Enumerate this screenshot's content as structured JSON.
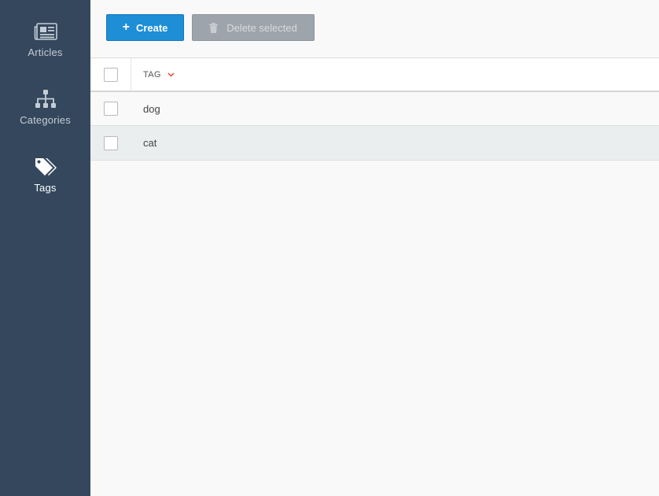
{
  "sidebar": {
    "items": [
      {
        "label": "Articles",
        "icon": "newspaper-icon",
        "active": false
      },
      {
        "label": "Categories",
        "icon": "sitemap-icon",
        "active": false
      },
      {
        "label": "Tags",
        "icon": "tags-icon",
        "active": true
      }
    ]
  },
  "toolbar": {
    "create_label": "Create",
    "delete_label": "Delete selected"
  },
  "table": {
    "columns": [
      {
        "label": "TAG",
        "sort": "descending"
      }
    ],
    "rows": [
      {
        "tag": "dog"
      },
      {
        "tag": "cat"
      }
    ]
  },
  "colors": {
    "sidebar_bg": "#34475c",
    "primary": "#1e8fd6",
    "disabled": "#9ea4ab",
    "sort_indicator": "#e0442c"
  }
}
